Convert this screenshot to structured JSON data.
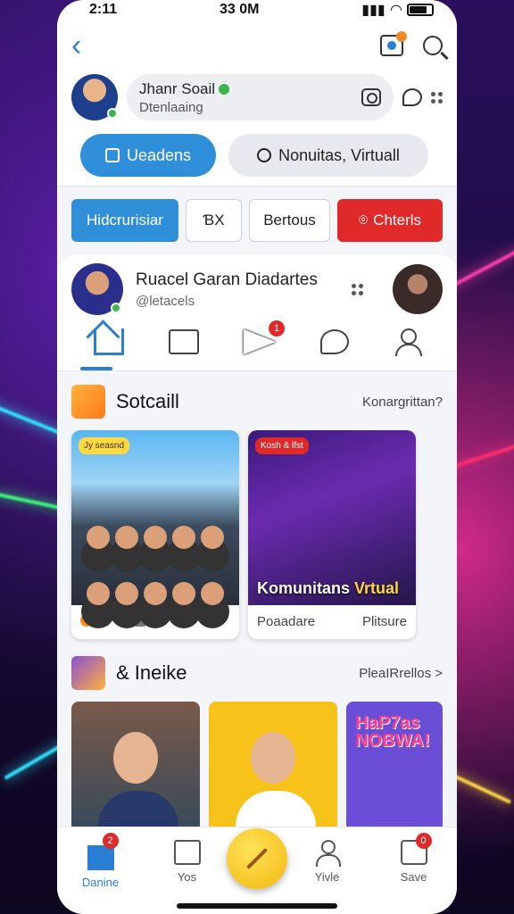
{
  "status": {
    "time": "2:11",
    "center": "33 0M"
  },
  "profile": {
    "name": "Jhanr Soail",
    "subtitle": "Dtenlaaing"
  },
  "tabs": [
    {
      "label": "Ueadens"
    },
    {
      "label": "Nonuitas, Virtuall"
    }
  ],
  "filters": [
    {
      "label": "Hidcrurisiar"
    },
    {
      "label": "ƁX"
    },
    {
      "label": "Bertous"
    },
    {
      "label": "Chterls"
    }
  ],
  "feed": {
    "name": "Ruacel Garan Diadartes",
    "handle": "@letacels",
    "nav_badge": "1"
  },
  "section1": {
    "title": "Sotcaill",
    "link": "Konargrittan?",
    "card1": {
      "tag": "Jy seasnd",
      "footer": ""
    },
    "card2": {
      "tag": "Kosh & lfst",
      "overlay_a": "Komunitans ",
      "overlay_b": "Vrtual",
      "footer_left": "Poaadare",
      "footer_right": "Plitsure"
    }
  },
  "section2": {
    "title": "& Ineike",
    "link": "PleaIRrellos >",
    "tile3_text": "HaP7as NOBWA!"
  },
  "bottom_nav": [
    {
      "label": "Danine",
      "badge": "2"
    },
    {
      "label": "Yos"
    },
    {
      "label": "Yivle"
    },
    {
      "label": "Save",
      "badge": "0"
    }
  ],
  "colors": {
    "accent": "#2f8fd8",
    "danger": "#e02a2a",
    "fab": "#f2b70c"
  }
}
